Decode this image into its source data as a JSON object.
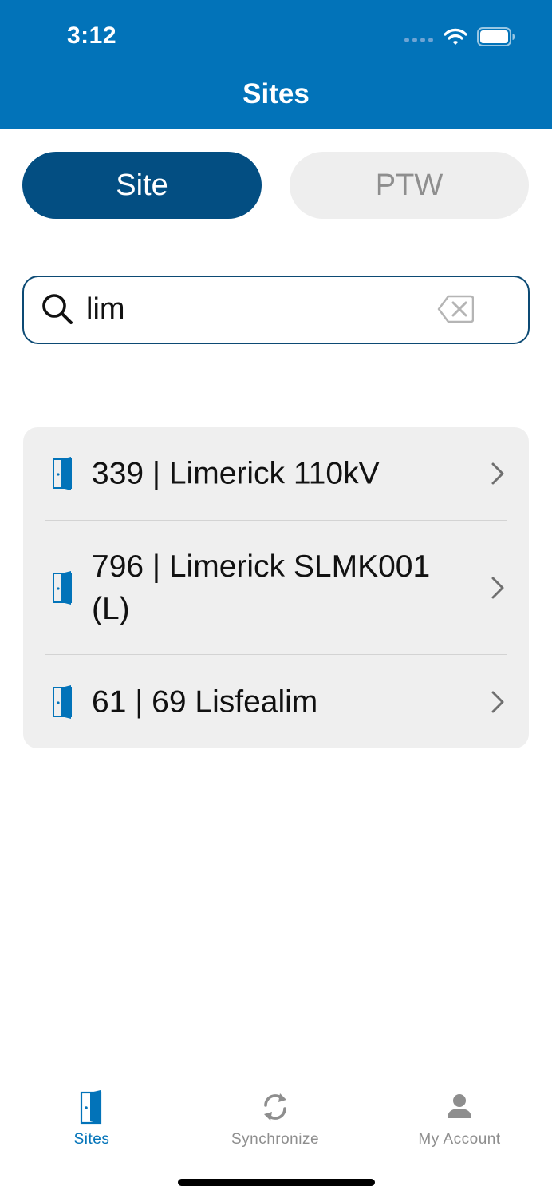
{
  "status_bar": {
    "time": "3:12"
  },
  "header": {
    "title": "Sites"
  },
  "segments": [
    {
      "label": "Site",
      "selected": true
    },
    {
      "label": "PTW",
      "selected": false
    }
  ],
  "search": {
    "value": "lim",
    "placeholder": ""
  },
  "sites": [
    {
      "label": "339 | Limerick 110kV",
      "icon": "door-icon"
    },
    {
      "label": "796 | Limerick SLMK001 (L)",
      "icon": "door-icon"
    },
    {
      "label": "61 | 69 Lisfealim",
      "icon": "door-icon"
    }
  ],
  "tabs": [
    {
      "label": "Sites",
      "icon": "door-icon",
      "active": true
    },
    {
      "label": "Synchronize",
      "icon": "sync-icon",
      "active": false
    },
    {
      "label": "My Account",
      "icon": "person-icon",
      "active": false
    }
  ],
  "colors": {
    "header": "#0273b9",
    "segment_selected": "#034e82",
    "segment_unselected": "#eeeeee",
    "accent": "#0273b9",
    "tab_inactive": "#8e8e8e"
  }
}
